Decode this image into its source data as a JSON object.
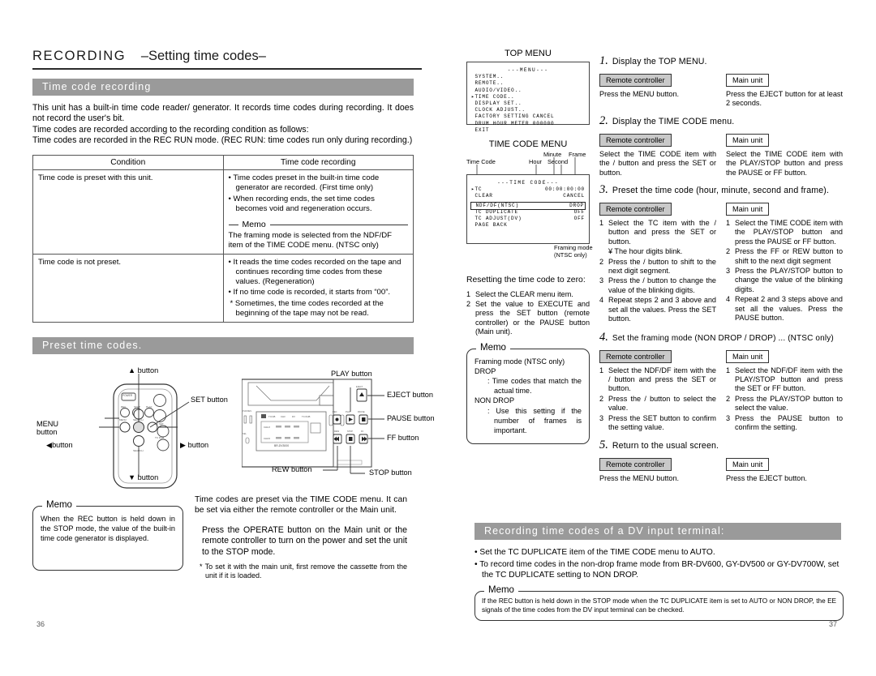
{
  "left_page": {
    "chapter": {
      "main": "RECORDING",
      "sub": "–Setting time codes–"
    },
    "section1_title": "Time code recording",
    "intro": [
      "This unit has a built-in time code reader/ generator. It records time codes during recording. It does not record the user's bit.",
      "Time codes are recorded according to the recording condition as follows:",
      "Time codes are recorded in the REC RUN mode. (REC RUN: time codes run only during recording.)"
    ],
    "table": {
      "headers": [
        "Condition",
        "Time code recording"
      ],
      "rows": [
        {
          "condition": "Time code is preset with this unit.",
          "bullets": [
            "Time codes preset in the built-in time code generator are recorded. (First time only)",
            "When recording ends, the set time codes becomes void and regeneration occurs."
          ],
          "memo_label": "Memo",
          "memo_text": "The framing mode is selected from the NDF/DF item of the TIME CODE menu. (NTSC only)"
        },
        {
          "condition": "Time code is not preset.",
          "bullets": [
            "It reads the time codes recorded on the tape and continues recording time codes from these values. (Regeneration)",
            "If no time code is recorded, it starts from “00”."
          ],
          "note": "Sometimes, the time codes recorded at the beginning of the tape may not be read."
        }
      ]
    },
    "section2_title": "Preset time codes.",
    "remote_labels": {
      "up": "▲ button",
      "set": "SET button",
      "menu": "MENU\nbutton",
      "left": "◀button",
      "right": "▶ button",
      "down": "▼ button"
    },
    "unit_labels": {
      "play": "PLAY button",
      "eject": "EJECT button",
      "pause": "PAUSE button",
      "ff": "FF button",
      "rew": "REW button",
      "stop": "STOP button",
      "model": "BR-DV3000"
    },
    "memo": {
      "title": "Memo",
      "text": "When the REC button is held down in the STOP mode, the value of the built-in time code generator is displayed."
    },
    "paragraphs": [
      "Time codes are preset via the TIME CODE menu. It can be set via either the remote controller or the Main unit.",
      "Press the OPERATE button on the Main unit or the remote controller to turn on the power and set the unit to the STOP mode.",
      "To set it with the main unit, first remove the cassette from the unit if it is loaded."
    ],
    "page_number": "36"
  },
  "right_page": {
    "top_menu": {
      "title": "TOP MENU",
      "header": "---MENU---",
      "items": [
        "SYSTEM..",
        "REMOTE..",
        "AUDIO/VIDEO..",
        "TIME CODE..",
        "DISPLAY SET..",
        "CLOCK ADJUST..",
        "FACTORY SETTING CANCEL",
        "DRUM HOUR METER 000000",
        "EXIT"
      ],
      "cursor_index": 3
    },
    "tc_menu": {
      "title": "TIME CODE MENU",
      "header": "---TIME CODE---",
      "callouts": {
        "time_code": "Time Code",
        "hour": "Hour",
        "minute": "Minute",
        "second": "Second",
        "frame": "Frame",
        "framing": "Framing mode\n(NTSC only)"
      },
      "rows": [
        {
          "label": "TC",
          "value": "00:00:00:00",
          "cursor": true
        },
        {
          "label": "CLEAR",
          "value": "CANCEL",
          "cursor": false
        },
        {
          "label": "NDF/DF(NTSC)",
          "value": "DROP",
          "cursor": false,
          "boxed": true
        },
        {
          "label": "TC DUPLICATE",
          "value": "OFF",
          "cursor": false
        },
        {
          "label": "TC ADJUST(DV)",
          "value": "OFF",
          "cursor": false
        },
        {
          "label": "PAGE BACK",
          "value": "",
          "cursor": false
        }
      ]
    },
    "reset": {
      "heading": "Resetting the time code to zero:",
      "steps": [
        "Select the CLEAR menu item.",
        "Set the value to EXECUTE and press the SET button (remote controller) or the PAUSE button (Main unit)."
      ]
    },
    "memo": {
      "title": "Memo",
      "lines": [
        "Framing mode (NTSC only)",
        "DROP",
        ": Time codes that match the actual time.",
        "NON DROP",
        ": Use this setting if the number of frames is important."
      ]
    },
    "labels": {
      "remote": "Remote controller",
      "main": "Main unit"
    },
    "steps": [
      {
        "num": "1.",
        "title": "Display the TOP MENU.",
        "remote_text": "Press the MENU button.",
        "main_text": "Press the EJECT button for at least 2 seconds."
      },
      {
        "num": "2.",
        "title": "Display the TIME CODE menu.",
        "remote_text": "Select the TIME CODE item with the  /  button and press the SET or   button.",
        "main_text": "Select the TIME CODE item with the PLAY/STOP button and press the PAUSE or FF button."
      },
      {
        "num": "3.",
        "title": "Preset the time code (hour, minute, second and frame).",
        "remote_list": [
          "Select the TC item with the  /  button and press the SET or   button.",
          "Press the  /  button to shift to the next digit segment.",
          "Press the  /  button to change the value of the blinking digits.",
          "Repeat steps 2  and 3 above and set all the values. Press the SET button."
        ],
        "remote_note": "¥  The hour digits blink.",
        "main_list": [
          "Select the TIME CODE item with the PLAY/STOP button and press the PAUSE or FF button.",
          "Press the FF or REW button to shift to the next digit segment",
          "Press the PLAY/STOP button to change the value of the blinking digits.",
          "Repeat 2  and 3  steps above and set all the values. Press the PAUSE button."
        ]
      },
      {
        "num": "4.",
        "title": "Set the framing mode (NON DROP / DROP) ... (NTSC only)",
        "remote_list": [
          "Select the NDF/DF item with the  /  button and press the SET or   button.",
          "Press the  /  button to select the value.",
          "Press the SET button to confirm the setting value."
        ],
        "main_list": [
          "Select the NDF/DF item with the PLAY/STOP button and press the SET or FF button.",
          "Press the PLAY/STOP button to select the value.",
          "Press the PAUSE button to confirm the setting."
        ]
      },
      {
        "num": "5.",
        "title": "Return to the usual screen.",
        "remote_text": "Press the MENU button.",
        "main_text": "Press the EJECT button."
      }
    ],
    "dv_section": {
      "title": "Recording time codes of a DV input terminal:",
      "bullets": [
        "Set the TC DUPLICATE item of the TIME CODE menu to AUTO.",
        "To record time codes in the non-drop frame mode from BR-DV600, GY-DV500 or GY-DV700W, set the TC DUPLICATE setting to NON DROP."
      ],
      "memo": {
        "title": "Memo",
        "text": "If the REC button is held down in the STOP mode when the TC DUPLICATE item is set to AUTO or NON DROP, the EE signals of the time codes from the DV input terminal can be checked."
      }
    },
    "page_number": "37"
  }
}
